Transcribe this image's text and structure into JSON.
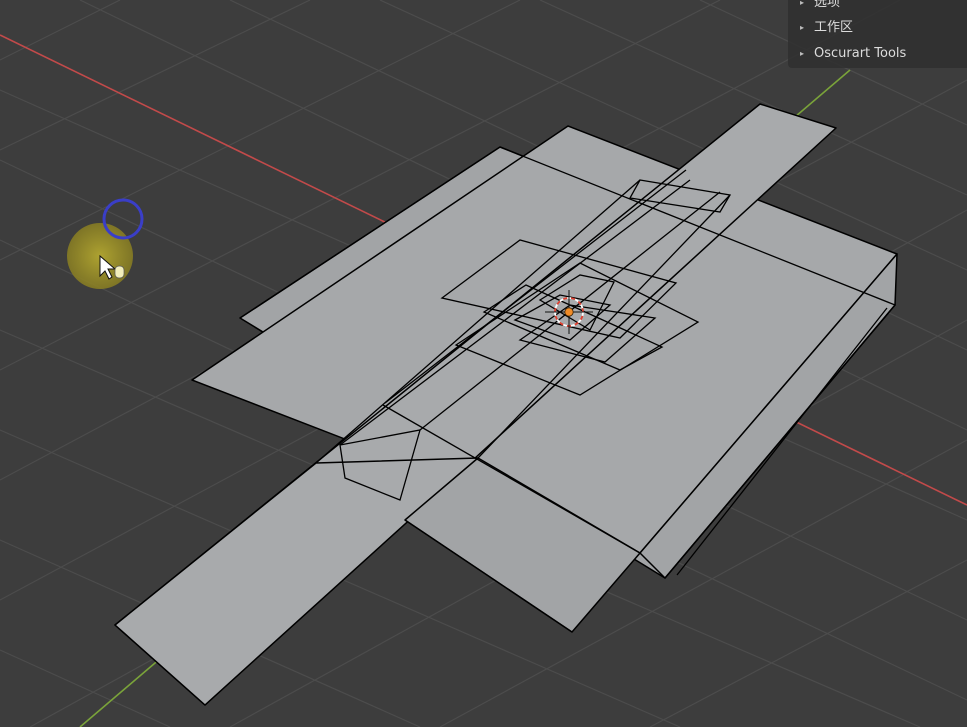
{
  "sidebar": {
    "items": [
      {
        "label": "选项",
        "arrow": "▸"
      },
      {
        "label": "工作区",
        "arrow": "▸"
      },
      {
        "label": "Oscurart Tools",
        "arrow": "▸"
      }
    ]
  },
  "colors": {
    "background": "#3d3d3d",
    "grid": "#4a4a4a",
    "x_axis": "#c24a4a",
    "y_axis": "#7aa33a",
    "mesh_face": "#a4a6a8",
    "mesh_edge": "#000000",
    "origin": "#f08c28",
    "cursor_highlight": "#b4a830",
    "cursor_ring": "#3a3ec8"
  },
  "icons": [
    "mouse-pointer-icon",
    "3d-cursor-icon",
    "origin-dot-icon",
    "expand-arrow-icon"
  ]
}
